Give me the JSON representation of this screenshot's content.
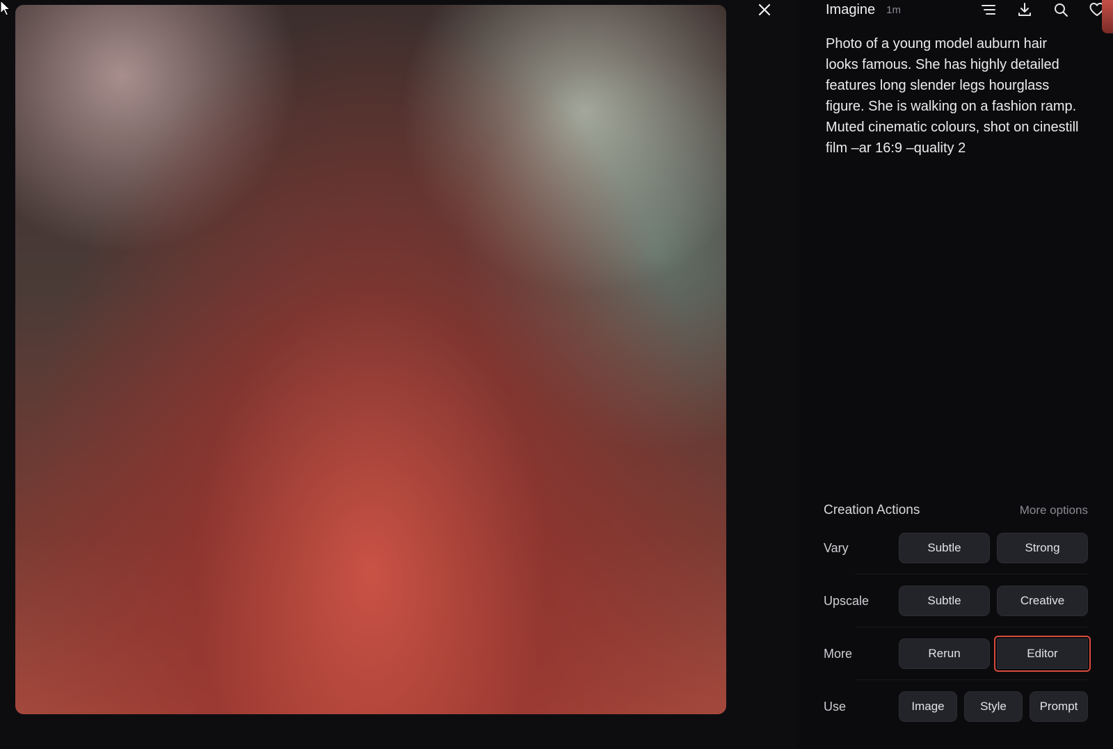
{
  "image_panel": {
    "placeholder_caption": "",
    "close_label": "Close"
  },
  "header": {
    "title": "Imagine",
    "time_ago": "1m",
    "icons": [
      "menu-icon",
      "download-icon",
      "search-icon",
      "heart-icon"
    ]
  },
  "prompt": "Photo of a young model auburn hair looks famous. She has highly detailed features long slender legs hourglass figure. She is walking on a fashion ramp. Muted cinematic colours, shot on cinestill film –ar 16:9 –quality 2",
  "creation_actions": {
    "title": "Creation Actions",
    "more_options": "More options",
    "rows": [
      {
        "label": "Vary",
        "buttons": [
          "Subtle",
          "Strong"
        ]
      },
      {
        "label": "Upscale",
        "buttons": [
          "Subtle",
          "Creative"
        ]
      },
      {
        "label": "More",
        "buttons": [
          "Rerun",
          "Editor"
        ]
      },
      {
        "label": "Use",
        "buttons": [
          "Image",
          "Style",
          "Prompt"
        ]
      }
    ],
    "highlight_color": "#d84b3c"
  }
}
